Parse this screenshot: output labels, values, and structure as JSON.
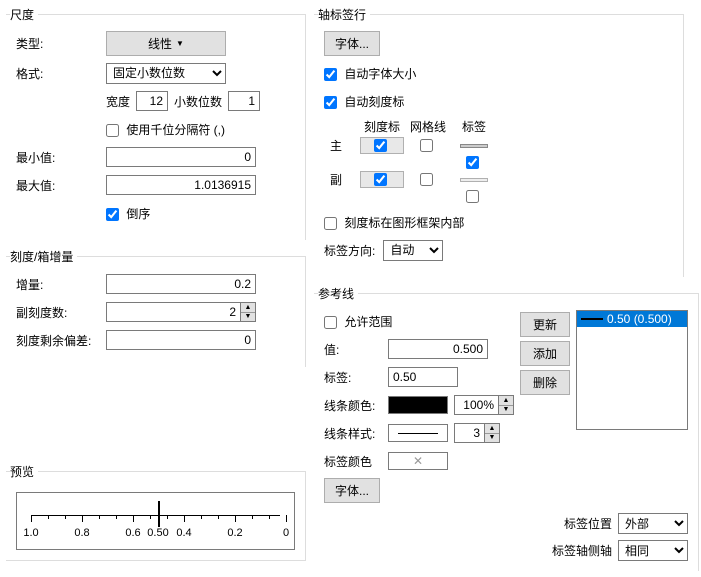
{
  "scale": {
    "legend": "尺度",
    "type_label": "类型:",
    "type_value": "线性",
    "format_label": "格式:",
    "format_value": "固定小数位数",
    "width_label": "宽度",
    "width_value": "12",
    "dec_label": "小数位数",
    "dec_value": "1",
    "thousands_label": "使用千位分隔符 (,)",
    "min_label": "最小值:",
    "min_value": "0",
    "max_label": "最大值:",
    "max_value": "1.0136915",
    "reverse_label": "倒序"
  },
  "increment": {
    "legend": "刻度/箱增量",
    "inc_label": "增量:",
    "inc_value": "0.2",
    "minor_label": "副刻度数:",
    "minor_value": "2",
    "offset_label": "刻度剩余偏差:",
    "offset_value": "0"
  },
  "axis": {
    "legend": "轴标签行",
    "font_btn": "字体...",
    "auto_font_label": "自动字体大小",
    "auto_tick_label": "自动刻度标",
    "hdr_tick": "刻度标",
    "hdr_grid": "网格线",
    "hdr_label": "标签",
    "row_major": "主",
    "row_minor": "副",
    "inside_label": "刻度标在图形框架内部",
    "orient_label": "标签方向:",
    "orient_value": "自动"
  },
  "ref": {
    "legend": "参考线",
    "allow_label": "允许范围",
    "update_btn": "更新",
    "add_btn": "添加",
    "del_btn": "删除",
    "value_label": "值:",
    "value_value": "0.500",
    "label_label": "标签:",
    "label_value": "0.50",
    "color_label": "线条颜色:",
    "pct_value": "100%",
    "style_label": "线条样式:",
    "style_value": "3",
    "lblcolor_label": "标签颜色",
    "font_btn": "字体...",
    "pos_label": "标签位置",
    "pos_value": "外部",
    "side_label": "标签轴侧轴",
    "side_value": "相同",
    "list_item": "0.50 (0.500)"
  },
  "preview": {
    "legend": "预览",
    "ticks": [
      "1.0",
      "0.8",
      "0.6",
      "0.50",
      "0.4",
      "0.2",
      "0"
    ]
  }
}
